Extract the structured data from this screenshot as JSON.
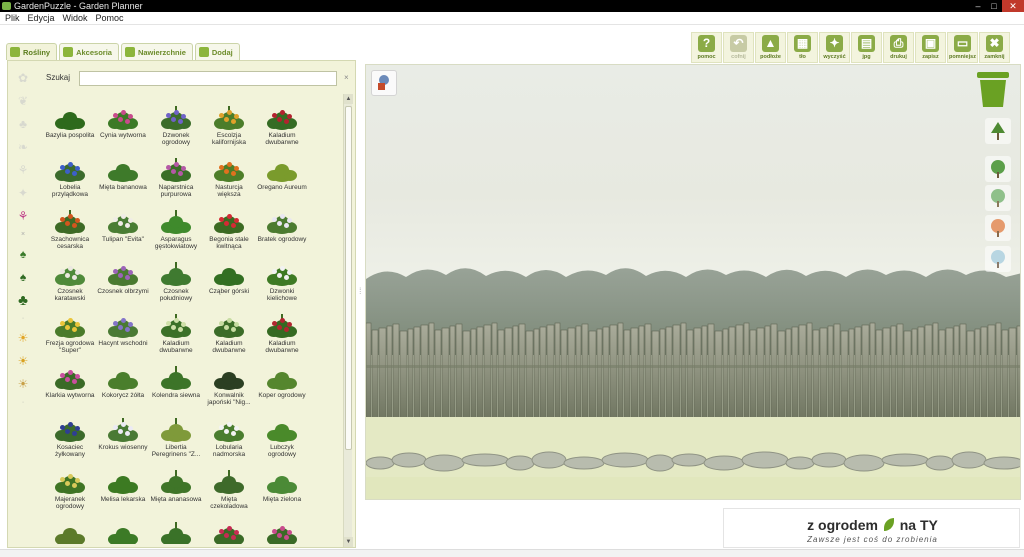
{
  "window": {
    "title": "GardenPuzzle - Garden Planner"
  },
  "menu": [
    "Plik",
    "Edycja",
    "Widok",
    "Pomoc"
  ],
  "tabs": [
    {
      "label": "Rośliny",
      "active": true
    },
    {
      "label": "Akcesoria",
      "active": false
    },
    {
      "label": "Nawierzchnie",
      "active": false
    },
    {
      "label": "Dodaj",
      "active": false
    }
  ],
  "toolbar": [
    {
      "label": "pomoc",
      "icon": "help-icon",
      "glyph": "?",
      "enabled": true
    },
    {
      "label": "cofnij",
      "icon": "undo-icon",
      "glyph": "↶",
      "enabled": false
    },
    {
      "label": "podłoże",
      "icon": "ground-icon",
      "glyph": "▲",
      "enabled": true
    },
    {
      "label": "tło",
      "icon": "background-icon",
      "glyph": "▦",
      "enabled": true
    },
    {
      "label": "wyczyść",
      "icon": "clear-icon",
      "glyph": "✦",
      "enabled": true
    },
    {
      "label": "jpg",
      "icon": "jpg-export-icon",
      "glyph": "▤",
      "enabled": true
    },
    {
      "label": "drukuj",
      "icon": "print-icon",
      "glyph": "⎙",
      "enabled": true
    },
    {
      "label": "zapisz",
      "icon": "save-icon",
      "glyph": "▣",
      "enabled": true
    },
    {
      "label": "pomniejsz",
      "icon": "minimize-icon",
      "glyph": "▭",
      "enabled": true
    },
    {
      "label": "zamknij",
      "icon": "close-icon",
      "glyph": "✖",
      "enabled": true
    }
  ],
  "search": {
    "label": "Szukaj",
    "value": "",
    "placeholder": "",
    "clear": "×"
  },
  "plants": [
    {
      "name": "Bazylia pospolita",
      "color": "#2e6a1c",
      "flower": ""
    },
    {
      "name": "Cynia wytworna",
      "color": "#3c7a26",
      "flower": "#c94b8c"
    },
    {
      "name": "Dzwonek ogrodowy",
      "color": "#3c6d2a",
      "flower": "#6f62c8"
    },
    {
      "name": "Escolzja kalifornijska",
      "color": "#4b7d2a",
      "flower": "#e0a12a"
    },
    {
      "name": "Kaladium dwubarwne",
      "color": "#356c24",
      "flower": "#b3222e"
    },
    {
      "name": "Lobelia przylądkowa",
      "color": "#3b6b2c",
      "flower": "#3d5fc9"
    },
    {
      "name": "Mięta bananowa",
      "color": "#3e7a2a",
      "flower": ""
    },
    {
      "name": "Naparstnica purpurowa",
      "color": "#3a6f27",
      "flower": "#b558a6"
    },
    {
      "name": "Nasturcja większa",
      "color": "#4d7e28",
      "flower": "#e0711e"
    },
    {
      "name": "Oregano Aureum",
      "color": "#7a9b2c",
      "flower": ""
    },
    {
      "name": "Szachownica cesarska",
      "color": "#3d6a25",
      "flower": "#d2561e"
    },
    {
      "name": "Tulipan \"Evita\"",
      "color": "#4a7d33",
      "flower": "#f0ece6"
    },
    {
      "name": "Asparagus gęstokwiatowy",
      "color": "#3f8a2c",
      "flower": ""
    },
    {
      "name": "Begonia stale kwitnąca",
      "color": "#3b6a22",
      "flower": "#d42a34"
    },
    {
      "name": "Bratek ogrodowy",
      "color": "#4c7b30",
      "flower": "#e9e6f2"
    },
    {
      "name": "Czosnek karatawski",
      "color": "#4f8a3a",
      "flower": "#ece8e0"
    },
    {
      "name": "Czosnek olbrzymi",
      "color": "#4a7a30",
      "flower": "#9c63b8"
    },
    {
      "name": "Czosnek południowy",
      "color": "#3f7a30",
      "flower": ""
    },
    {
      "name": "Cząber górski",
      "color": "#336f22",
      "flower": ""
    },
    {
      "name": "Dzwonki kielichowe",
      "color": "#3e7a24",
      "flower": "#f2f2f2"
    },
    {
      "name": "Frezja ogrodowa \"Super\"",
      "color": "#4a7b2a",
      "flower": "#e9c53a"
    },
    {
      "name": "Hacynt wschodni",
      "color": "#4a7a34",
      "flower": "#8474c9"
    },
    {
      "name": "Kaladium dwubarwne",
      "color": "#3c7128",
      "flower": "#cfe0a8"
    },
    {
      "name": "Kaladium dwubarwne",
      "color": "#3b6c28",
      "flower": "#c7dca2"
    },
    {
      "name": "Kaladium dwubarwne",
      "color": "#356a22",
      "flower": "#b22630"
    },
    {
      "name": "Klarkia wytworna",
      "color": "#3a6a26",
      "flower": "#c94e9e"
    },
    {
      "name": "Kokorycz żółta",
      "color": "#4a7e2c",
      "flower": ""
    },
    {
      "name": "Kolendra siewna",
      "color": "#3c7428",
      "flower": ""
    },
    {
      "name": "Konwalnik japoński \"Nig...",
      "color": "#2b3f22",
      "flower": ""
    },
    {
      "name": "Koper ogrodowy",
      "color": "#55862e",
      "flower": ""
    },
    {
      "name": "Kosaciec żyłkowany",
      "color": "#3b6a2a",
      "flower": "#2f3e93"
    },
    {
      "name": "Krokus wiosenny",
      "color": "#4a7a35",
      "flower": "#eceaf4"
    },
    {
      "name": "Libertia Peregrinens \"Z...",
      "color": "#7f9a3a",
      "flower": ""
    },
    {
      "name": "Lobularia nadmorska",
      "color": "#4a7d2e",
      "flower": "#f3f3f3"
    },
    {
      "name": "Lubczyk ogrodowy",
      "color": "#4a8a2a",
      "flower": ""
    },
    {
      "name": "Majeranek ogrodowy",
      "color": "#3f7424",
      "flower": "#d8c95a"
    },
    {
      "name": "Melisa lekarska",
      "color": "#3c7a22",
      "flower": ""
    },
    {
      "name": "Mięta ananasowa",
      "color": "#3f7528",
      "flower": ""
    },
    {
      "name": "Mięta czekoladowa",
      "color": "#3e6a2a",
      "flower": ""
    },
    {
      "name": "Mięta zielona",
      "color": "#4b8a36",
      "flower": ""
    },
    {
      "name": "",
      "color": "#5c7a2a",
      "flower": ""
    },
    {
      "name": "",
      "color": "#3c7a26",
      "flower": ""
    },
    {
      "name": "",
      "color": "#3a7228",
      "flower": ""
    },
    {
      "name": "",
      "color": "#3a6a26",
      "flower": "#c62b53"
    },
    {
      "name": "",
      "color": "#3a6a26",
      "flower": "#c94b8c"
    }
  ],
  "logo": {
    "title_before": "z ogrodem",
    "title_after": "na TY",
    "tagline": "Zawsze jest coś do zrobienia"
  },
  "colors": {
    "accent": "#8bab47",
    "panel": "#f2f3da",
    "trash": "#6aa123"
  }
}
